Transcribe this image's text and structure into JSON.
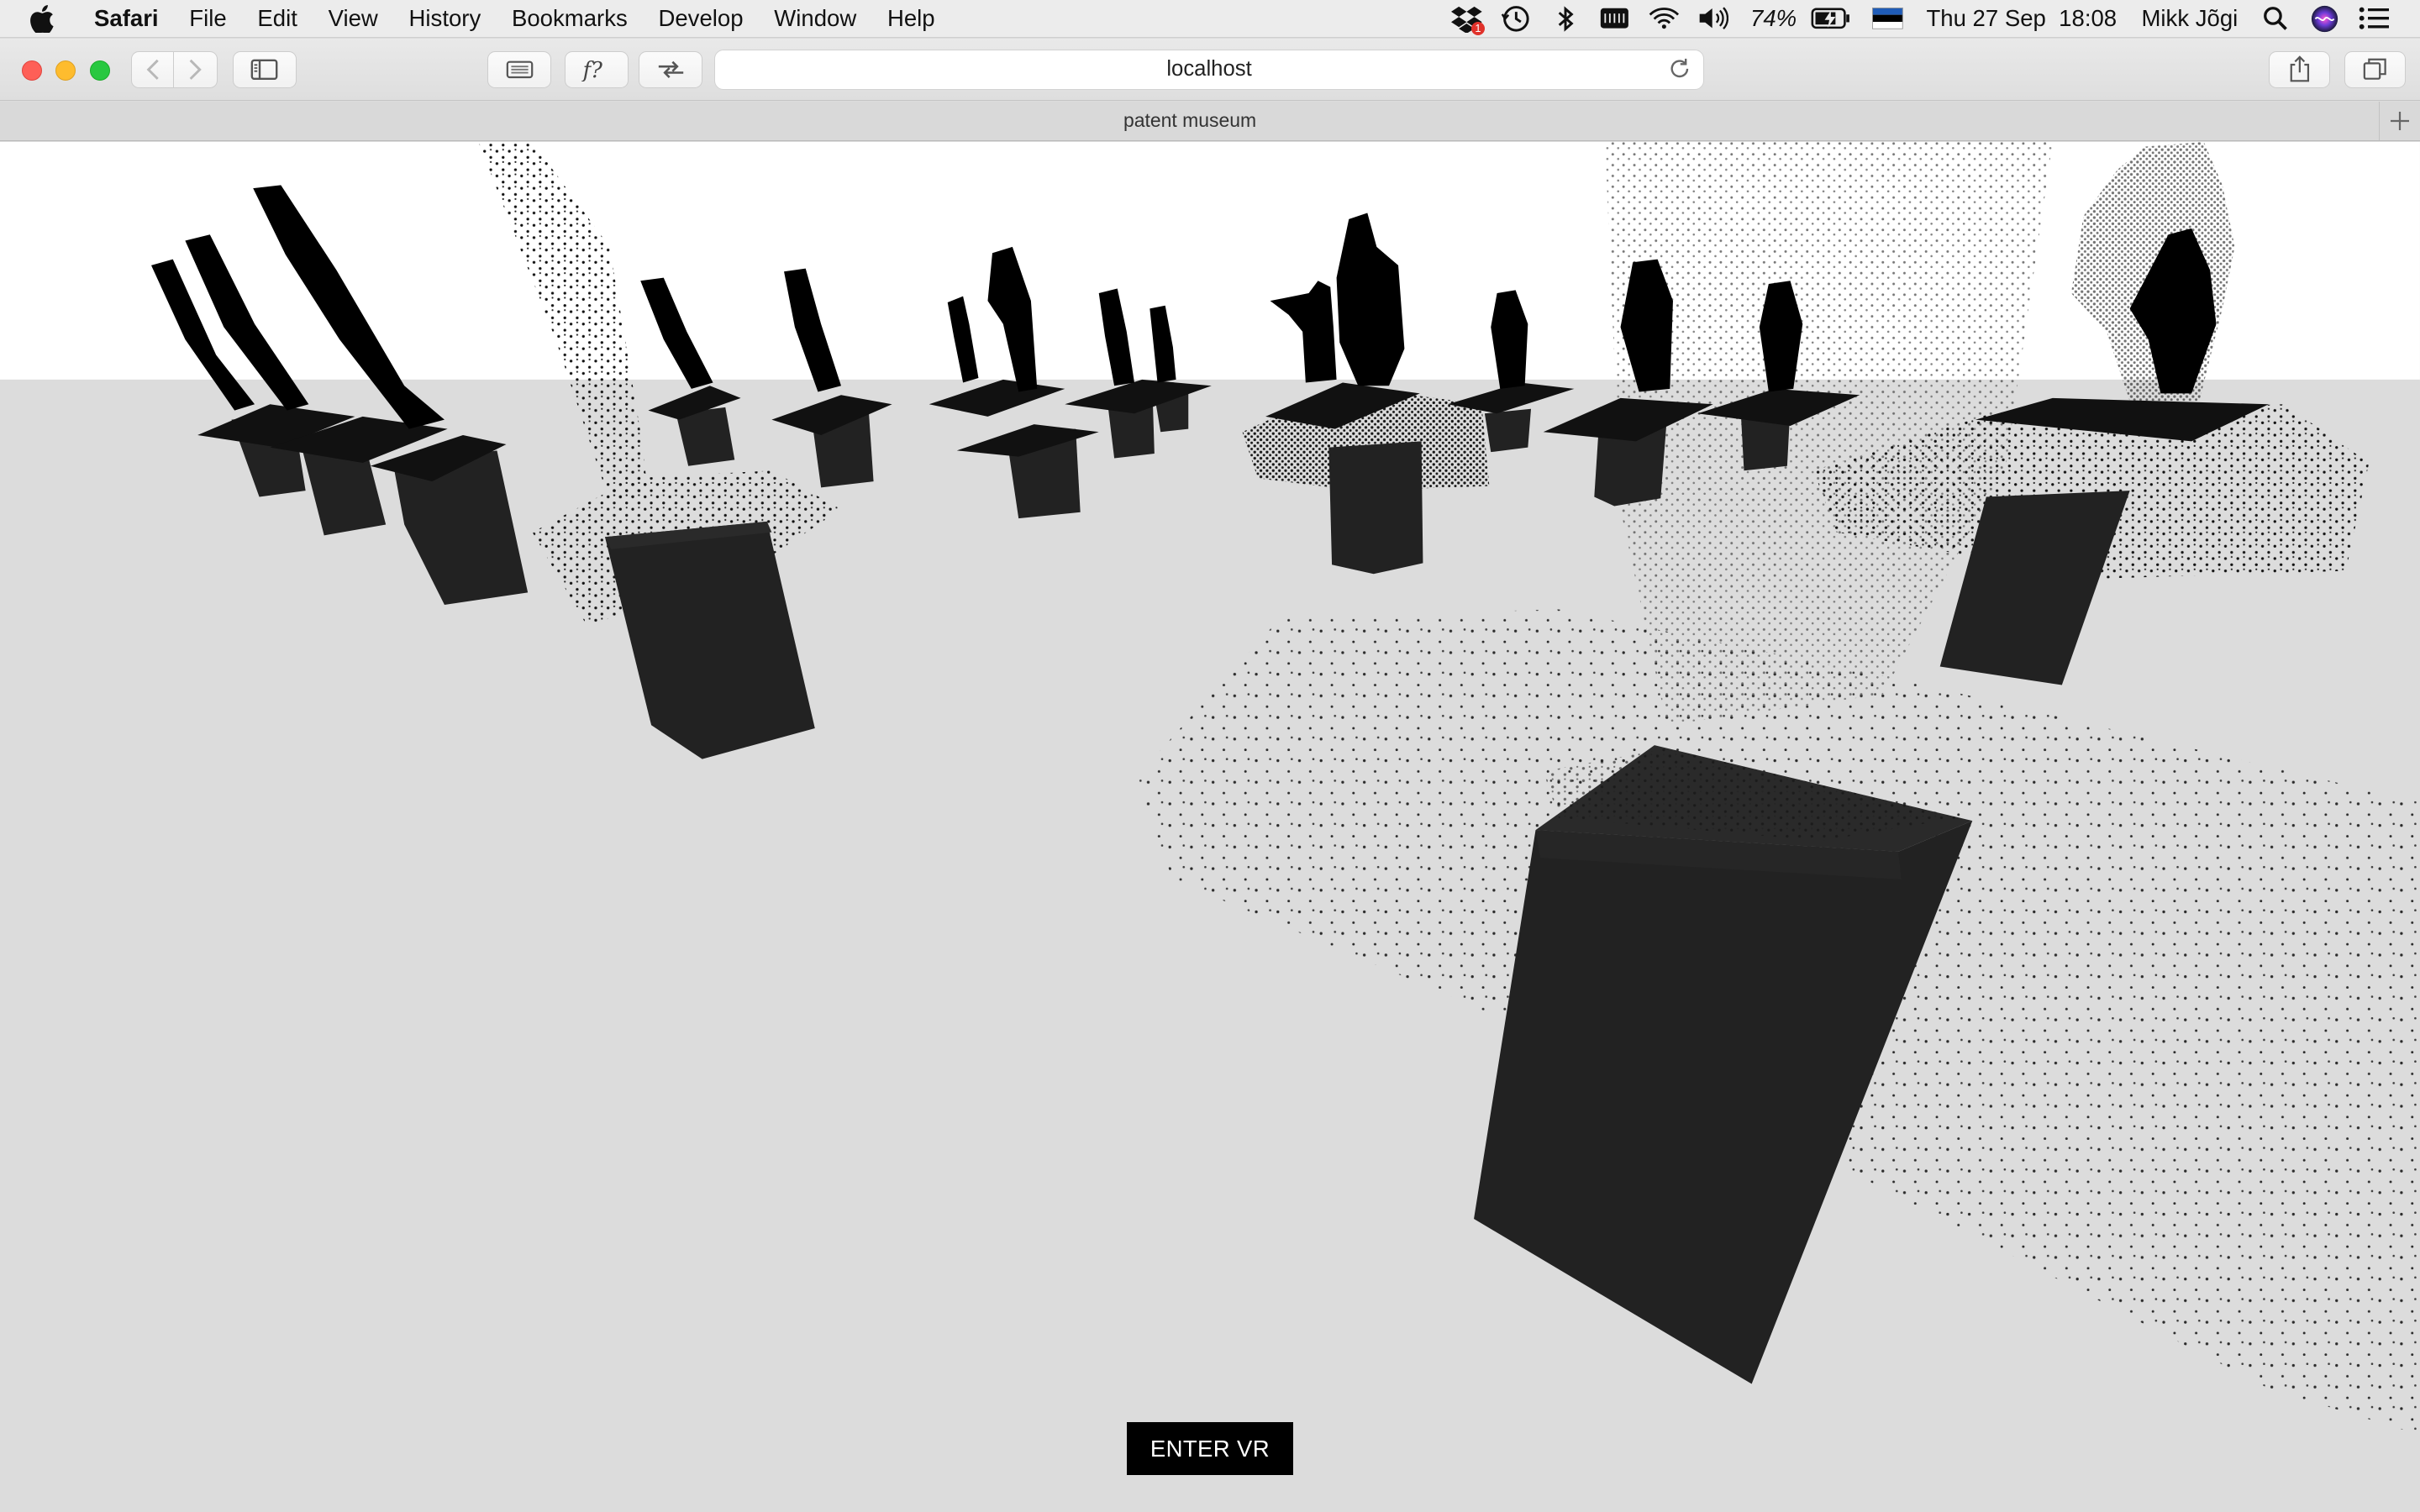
{
  "menubar": {
    "app_name": "Safari",
    "items": [
      "File",
      "Edit",
      "View",
      "History",
      "Bookmarks",
      "Develop",
      "Window",
      "Help"
    ],
    "status": {
      "battery_percent": "74%",
      "datetime": "Thu 27 Sep  18:08",
      "user": "Mikk Jõgi",
      "dropbox_badge": "1"
    },
    "icons": [
      "apple-icon",
      "dropbox-icon",
      "time-machine-icon",
      "bluetooth-icon",
      "keyboard-icon",
      "wifi-icon",
      "volume-icon",
      "battery-icon",
      "flag-icon",
      "spotlight-icon",
      "siri-icon",
      "notification-center-icon"
    ]
  },
  "browser": {
    "url": "localhost",
    "tab_title": "patent museum",
    "toolbar_icons": [
      "back-icon",
      "forward-icon",
      "sidebar-icon",
      "reader-icon",
      "formula-icon",
      "responsive-icon",
      "reload-icon",
      "share-icon",
      "tabs-overview-icon",
      "new-tab-icon"
    ]
  },
  "scene": {
    "description_hidden": false,
    "enter_vr_label": "ENTER VR",
    "floor_color": "#dcdcdc",
    "sky_color": "#ffffff",
    "pedestal_color": "#222222"
  }
}
